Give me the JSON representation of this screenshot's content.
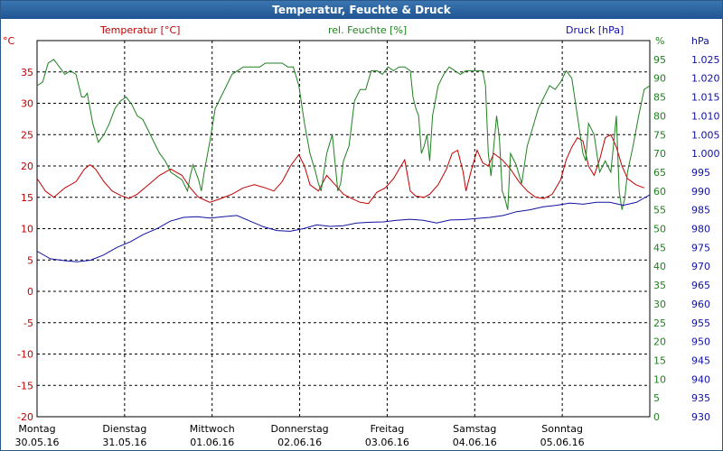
{
  "window": {
    "title": "Temperatur, Feuchte & Druck"
  },
  "chart_data": {
    "type": "line",
    "title": "Temperatur, Feuchte & Druck",
    "grid": true,
    "x": {
      "range": [
        0,
        7
      ],
      "days": [
        {
          "weekday": "Montag",
          "date": "30.05.16"
        },
        {
          "weekday": "Dienstag",
          "date": "31.05.16"
        },
        {
          "weekday": "Mittwoch",
          "date": "01.06.16"
        },
        {
          "weekday": "Donnerstag",
          "date": "02.06.16"
        },
        {
          "weekday": "Freitag",
          "date": "03.06.16"
        },
        {
          "weekday": "Samstag",
          "date": "04.06.16"
        },
        {
          "weekday": "Sonntag",
          "date": "05.06.16"
        }
      ]
    },
    "axes": {
      "left": {
        "label": "Temperatur [°C]",
        "unit": "°C",
        "color": "#c00000",
        "range": [
          -20,
          40
        ],
        "ticks": [
          "-20",
          "-15",
          "-10",
          "-5",
          "0",
          "5",
          "10",
          "15",
          "20",
          "25",
          "30",
          "35"
        ]
      },
      "right1": {
        "label": "rel. Feuchte [%]",
        "unit": "%",
        "color": "#208020",
        "range": [
          0,
          100
        ],
        "ticks": [
          "0",
          "5",
          "10",
          "15",
          "20",
          "25",
          "30",
          "35",
          "40",
          "45",
          "50",
          "55",
          "60",
          "65",
          "70",
          "75",
          "80",
          "85",
          "90",
          "95"
        ]
      },
      "right2": {
        "label": "Druck [hPa]",
        "unit": "hPa",
        "color": "#1010a0",
        "range": [
          930,
          1030
        ],
        "ticks": [
          "930",
          "935",
          "940",
          "945",
          "950",
          "955",
          "960",
          "965",
          "970",
          "975",
          "980",
          "985",
          "990",
          "995",
          "1.000",
          "1.005",
          "1.010",
          "1.015",
          "1.020",
          "1.025"
        ]
      }
    },
    "series": [
      {
        "name": "Temperatur [°C]",
        "axis": "left",
        "color": "#c00000",
        "points": [
          [
            0,
            18
          ],
          [
            0.15,
            16
          ],
          [
            0.3,
            15
          ],
          [
            0.5,
            16.5
          ],
          [
            0.7,
            17.5
          ],
          [
            0.85,
            19.5
          ],
          [
            0.95,
            20.2
          ],
          [
            1.05,
            19.5
          ],
          [
            1.2,
            17.5
          ],
          [
            1.35,
            16
          ],
          [
            1.5,
            15.3
          ],
          [
            1.65,
            14.8
          ],
          [
            1.8,
            15.5
          ],
          [
            2.0,
            17
          ],
          [
            2.2,
            18.5
          ],
          [
            2.4,
            19.5
          ],
          [
            2.6,
            18.5
          ],
          [
            2.75,
            16.5
          ],
          [
            2.9,
            15
          ],
          [
            3.1,
            14.2
          ],
          [
            3.3,
            14.8
          ],
          [
            3.5,
            15.5
          ],
          [
            3.7,
            16.5
          ],
          [
            3.9,
            17
          ],
          [
            4.1,
            16.5
          ],
          [
            4.25,
            16
          ],
          [
            4.4,
            17.5
          ],
          [
            4.55,
            20
          ],
          [
            4.7,
            21.8
          ],
          [
            4.8,
            20
          ],
          [
            4.9,
            17
          ],
          [
            5.05,
            16
          ],
          [
            5.2,
            18.5
          ],
          [
            5.35,
            17
          ],
          [
            5.5,
            15.5
          ],
          [
            5.65,
            14.8
          ],
          [
            5.8,
            14.2
          ],
          [
            5.95,
            14
          ],
          [
            6.1,
            15.8
          ],
          [
            6.25,
            16.5
          ],
          [
            6.4,
            18
          ],
          [
            6.5,
            19.5
          ],
          [
            6.6,
            21
          ],
          [
            6.65,
            18.5
          ],
          [
            6.7,
            16
          ],
          [
            6.8,
            15.2
          ],
          [
            6.95,
            15
          ],
          [
            7.05,
            15.5
          ],
          [
            7.2,
            17
          ],
          [
            7.35,
            19.5
          ],
          [
            7.45,
            22
          ],
          [
            7.55,
            22.5
          ],
          [
            7.65,
            19
          ],
          [
            7.7,
            16
          ],
          [
            7.8,
            19.5
          ],
          [
            7.9,
            22.5
          ],
          [
            8.0,
            20.5
          ],
          [
            8.1,
            20
          ],
          [
            8.2,
            22
          ],
          [
            8.35,
            21
          ],
          [
            8.5,
            19.5
          ],
          [
            8.65,
            17.5
          ],
          [
            8.8,
            16
          ],
          [
            8.95,
            15
          ],
          [
            9.1,
            14.8
          ],
          [
            9.25,
            15.5
          ],
          [
            9.4,
            17.8
          ],
          [
            9.5,
            21
          ],
          [
            9.6,
            23
          ],
          [
            9.7,
            24.5
          ],
          [
            9.8,
            24
          ],
          [
            9.9,
            20
          ],
          [
            10.0,
            18.5
          ],
          [
            10.1,
            21
          ],
          [
            10.2,
            24.5
          ],
          [
            10.3,
            25
          ],
          [
            10.4,
            23
          ],
          [
            10.5,
            20
          ],
          [
            10.6,
            18
          ],
          [
            10.75,
            17
          ],
          [
            10.9,
            16.5
          ]
        ]
      },
      {
        "name": "rel. Feuchte [%]",
        "axis": "right1",
        "color": "#208020",
        "points": [
          [
            0,
            88
          ],
          [
            0.1,
            89
          ],
          [
            0.2,
            94
          ],
          [
            0.3,
            95
          ],
          [
            0.4,
            93
          ],
          [
            0.5,
            91
          ],
          [
            0.6,
            92
          ],
          [
            0.7,
            91
          ],
          [
            0.75,
            88
          ],
          [
            0.8,
            85
          ],
          [
            0.85,
            85
          ],
          [
            0.9,
            86
          ],
          [
            0.95,
            82
          ],
          [
            1.0,
            78
          ],
          [
            1.1,
            73
          ],
          [
            1.2,
            75
          ],
          [
            1.3,
            78
          ],
          [
            1.4,
            82
          ],
          [
            1.5,
            84
          ],
          [
            1.6,
            85
          ],
          [
            1.7,
            83
          ],
          [
            1.8,
            80
          ],
          [
            1.9,
            79
          ],
          [
            2.0,
            76
          ],
          [
            2.1,
            73
          ],
          [
            2.2,
            70
          ],
          [
            2.3,
            68
          ],
          [
            2.4,
            65
          ],
          [
            2.5,
            64
          ],
          [
            2.6,
            63
          ],
          [
            2.7,
            60
          ],
          [
            2.75,
            64
          ],
          [
            2.8,
            67
          ],
          [
            2.9,
            63
          ],
          [
            2.95,
            60
          ],
          [
            3.0,
            65
          ],
          [
            3.1,
            73
          ],
          [
            3.2,
            82
          ],
          [
            3.3,
            85
          ],
          [
            3.4,
            88
          ],
          [
            3.5,
            91
          ],
          [
            3.6,
            92
          ],
          [
            3.7,
            93
          ],
          [
            3.8,
            93
          ],
          [
            3.9,
            93
          ],
          [
            4.0,
            93
          ],
          [
            4.1,
            94
          ],
          [
            4.2,
            94
          ],
          [
            4.3,
            94
          ],
          [
            4.4,
            94
          ],
          [
            4.5,
            93
          ],
          [
            4.6,
            93
          ],
          [
            4.7,
            88
          ],
          [
            4.8,
            78
          ],
          [
            4.9,
            70
          ],
          [
            5.0,
            65
          ],
          [
            5.05,
            62
          ],
          [
            5.1,
            60
          ],
          [
            5.2,
            70
          ],
          [
            5.3,
            75
          ],
          [
            5.4,
            60
          ],
          [
            5.45,
            62
          ],
          [
            5.5,
            68
          ],
          [
            5.6,
            72
          ],
          [
            5.7,
            84
          ],
          [
            5.8,
            87
          ],
          [
            5.9,
            87
          ],
          [
            6.0,
            92
          ],
          [
            6.1,
            92
          ],
          [
            6.2,
            91
          ],
          [
            6.3,
            93
          ],
          [
            6.4,
            92
          ],
          [
            6.5,
            93
          ],
          [
            6.6,
            93
          ],
          [
            6.7,
            92
          ],
          [
            6.75,
            85
          ],
          [
            6.8,
            82
          ],
          [
            6.85,
            80
          ],
          [
            6.9,
            70
          ],
          [
            6.95,
            72
          ],
          [
            7.0,
            75
          ],
          [
            7.05,
            68
          ],
          [
            7.1,
            80
          ],
          [
            7.2,
            88
          ],
          [
            7.3,
            91
          ],
          [
            7.4,
            93
          ],
          [
            7.5,
            92
          ],
          [
            7.6,
            91
          ],
          [
            7.7,
            92
          ],
          [
            7.8,
            92
          ],
          [
            7.9,
            92
          ],
          [
            8.0,
            92
          ],
          [
            8.05,
            88
          ],
          [
            8.1,
            70
          ],
          [
            8.15,
            64
          ],
          [
            8.2,
            72
          ],
          [
            8.25,
            80
          ],
          [
            8.3,
            74
          ],
          [
            8.35,
            60
          ],
          [
            8.4,
            58
          ],
          [
            8.45,
            55
          ],
          [
            8.5,
            70
          ],
          [
            8.6,
            67
          ],
          [
            8.7,
            62
          ],
          [
            8.8,
            72
          ],
          [
            8.9,
            77
          ],
          [
            9.0,
            82
          ],
          [
            9.1,
            85
          ],
          [
            9.2,
            88
          ],
          [
            9.3,
            87
          ],
          [
            9.4,
            89
          ],
          [
            9.5,
            92
          ],
          [
            9.6,
            90
          ],
          [
            9.7,
            80
          ],
          [
            9.8,
            70
          ],
          [
            9.85,
            68
          ],
          [
            9.9,
            78
          ],
          [
            10.0,
            75
          ],
          [
            10.05,
            70
          ],
          [
            10.1,
            65
          ],
          [
            10.2,
            68
          ],
          [
            10.3,
            65
          ],
          [
            10.4,
            80
          ],
          [
            10.45,
            60
          ],
          [
            10.5,
            55
          ],
          [
            10.55,
            58
          ],
          [
            10.6,
            65
          ],
          [
            10.7,
            72
          ],
          [
            10.8,
            80
          ],
          [
            10.9,
            87
          ],
          [
            11.0,
            88
          ]
        ]
      },
      {
        "name": "Druck [hPa]",
        "axis": "right2",
        "color": "#1010a0",
        "points": [
          [
            0,
            974
          ],
          [
            0.3,
            972
          ],
          [
            0.6,
            971.5
          ],
          [
            0.9,
            971.2
          ],
          [
            1.2,
            971.6
          ],
          [
            1.5,
            973
          ],
          [
            1.8,
            975
          ],
          [
            2.1,
            976.5
          ],
          [
            2.4,
            978.5
          ],
          [
            2.7,
            980
          ],
          [
            3.0,
            982
          ],
          [
            3.3,
            983
          ],
          [
            3.6,
            983.2
          ],
          [
            3.9,
            982.8
          ],
          [
            4.2,
            983.2
          ],
          [
            4.5,
            983.5
          ],
          [
            4.8,
            982
          ],
          [
            5.1,
            980.5
          ],
          [
            5.4,
            979.5
          ],
          [
            5.7,
            979.3
          ],
          [
            6.0,
            980
          ],
          [
            6.3,
            981
          ],
          [
            6.6,
            980.6
          ],
          [
            6.9,
            980.8
          ],
          [
            7.2,
            981.5
          ],
          [
            7.5,
            981.7
          ],
          [
            7.8,
            981.8
          ],
          [
            8.1,
            982.2
          ],
          [
            8.4,
            982.5
          ],
          [
            8.7,
            982.2
          ],
          [
            9.0,
            981.5
          ],
          [
            9.3,
            982.3
          ],
          [
            9.6,
            982.4
          ],
          [
            9.9,
            982.7
          ],
          [
            10.2,
            983
          ],
          [
            10.5,
            983.5
          ],
          [
            10.8,
            984.5
          ],
          [
            11.1,
            985
          ],
          [
            11.4,
            985.8
          ],
          [
            11.7,
            986.2
          ],
          [
            12.0,
            986.8
          ],
          [
            12.3,
            986.5
          ],
          [
            12.6,
            987
          ],
          [
            12.9,
            987
          ],
          [
            13.2,
            986.2
          ],
          [
            13.5,
            987
          ],
          [
            13.8,
            989
          ]
        ]
      }
    ]
  }
}
